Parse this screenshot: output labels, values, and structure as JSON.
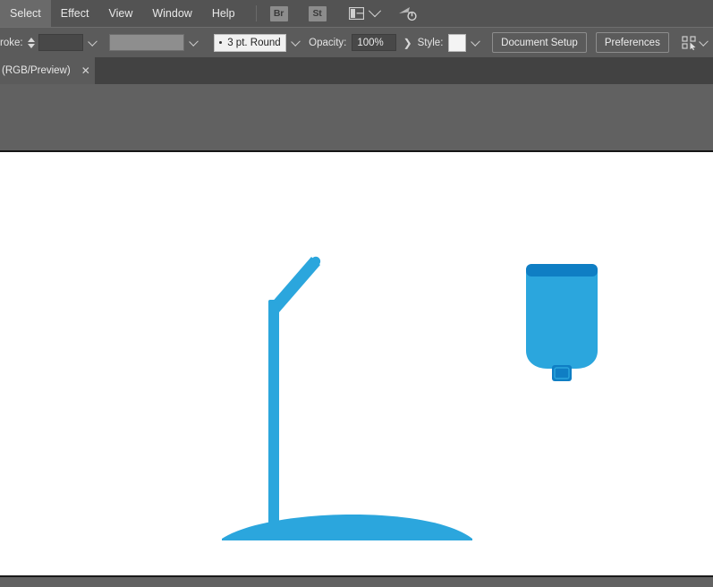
{
  "menubar": {
    "items": [
      {
        "label": "Select"
      },
      {
        "label": "Effect"
      },
      {
        "label": "View"
      },
      {
        "label": "Window"
      },
      {
        "label": "Help"
      }
    ],
    "bridge_label": "Br",
    "stock_label": "St",
    "arrange_icon": "arrange-documents-icon",
    "workspace_icon": "workspace-switcher-icon"
  },
  "controlbar": {
    "stroke_label": "roke:",
    "stroke_weight_value": "",
    "stroke_profile_value": "",
    "brush_definition": "3 pt. Round",
    "opacity_label": "Opacity:",
    "opacity_value": "100%",
    "style_label": "Style:",
    "style_value": "",
    "document_setup_label": "Document Setup",
    "preferences_label": "Preferences",
    "select_similar_icon": "select-similar-objects-icon"
  },
  "tabbar": {
    "document_tab_label": "(RGB/Preview)",
    "close_label": "✕"
  },
  "artwork": {
    "colors": {
      "primary_blue": "#2ba6dd",
      "dark_blue": "#0f7ec4",
      "canvas_white": "#ffffff"
    },
    "objects": [
      {
        "name": "floor-lamp-shape",
        "color": "#2ba6dd"
      },
      {
        "name": "container-shape",
        "color": "#2ba6dd"
      }
    ]
  },
  "theme": {
    "menubar_bg": "#535353",
    "controlbar_bg": "#5b5b5b",
    "tabbar_bg": "#424242",
    "workspace_bg": "#616161"
  }
}
